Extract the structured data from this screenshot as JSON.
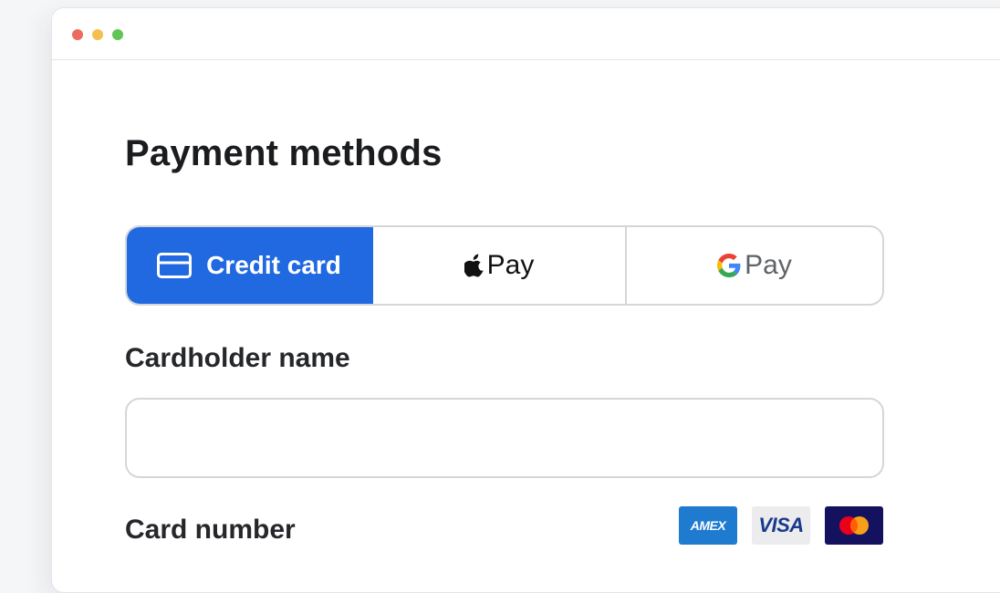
{
  "window": {
    "controls": [
      "close",
      "minimize",
      "zoom"
    ]
  },
  "page": {
    "title": "Payment methods"
  },
  "methods": {
    "credit_card": {
      "label": "Credit card",
      "icon": "credit-card-icon",
      "selected": true
    },
    "apple_pay": {
      "label": "Pay",
      "icon": "apple-logo-icon"
    },
    "google_pay": {
      "label": "Pay",
      "icon": "google-g-logo-icon"
    }
  },
  "form": {
    "cardholder_name": {
      "label": "Cardholder name",
      "value": "",
      "placeholder": ""
    },
    "card_number": {
      "label": "Card number",
      "brands": [
        {
          "name": "AMEX",
          "icon": "amex-logo-icon"
        },
        {
          "name": "VISA",
          "icon": "visa-logo-icon"
        },
        {
          "name": "Mastercard",
          "icon": "mastercard-logo-icon"
        }
      ]
    }
  },
  "colors": {
    "accent": "#2169e0",
    "amex": "#1f7bd0",
    "visa_bg": "#ececee",
    "visa_text": "#173a8c",
    "mastercard_bg": "#14125e",
    "mastercard_red": "#eb001b",
    "mastercard_orange": "#f79e1b"
  }
}
